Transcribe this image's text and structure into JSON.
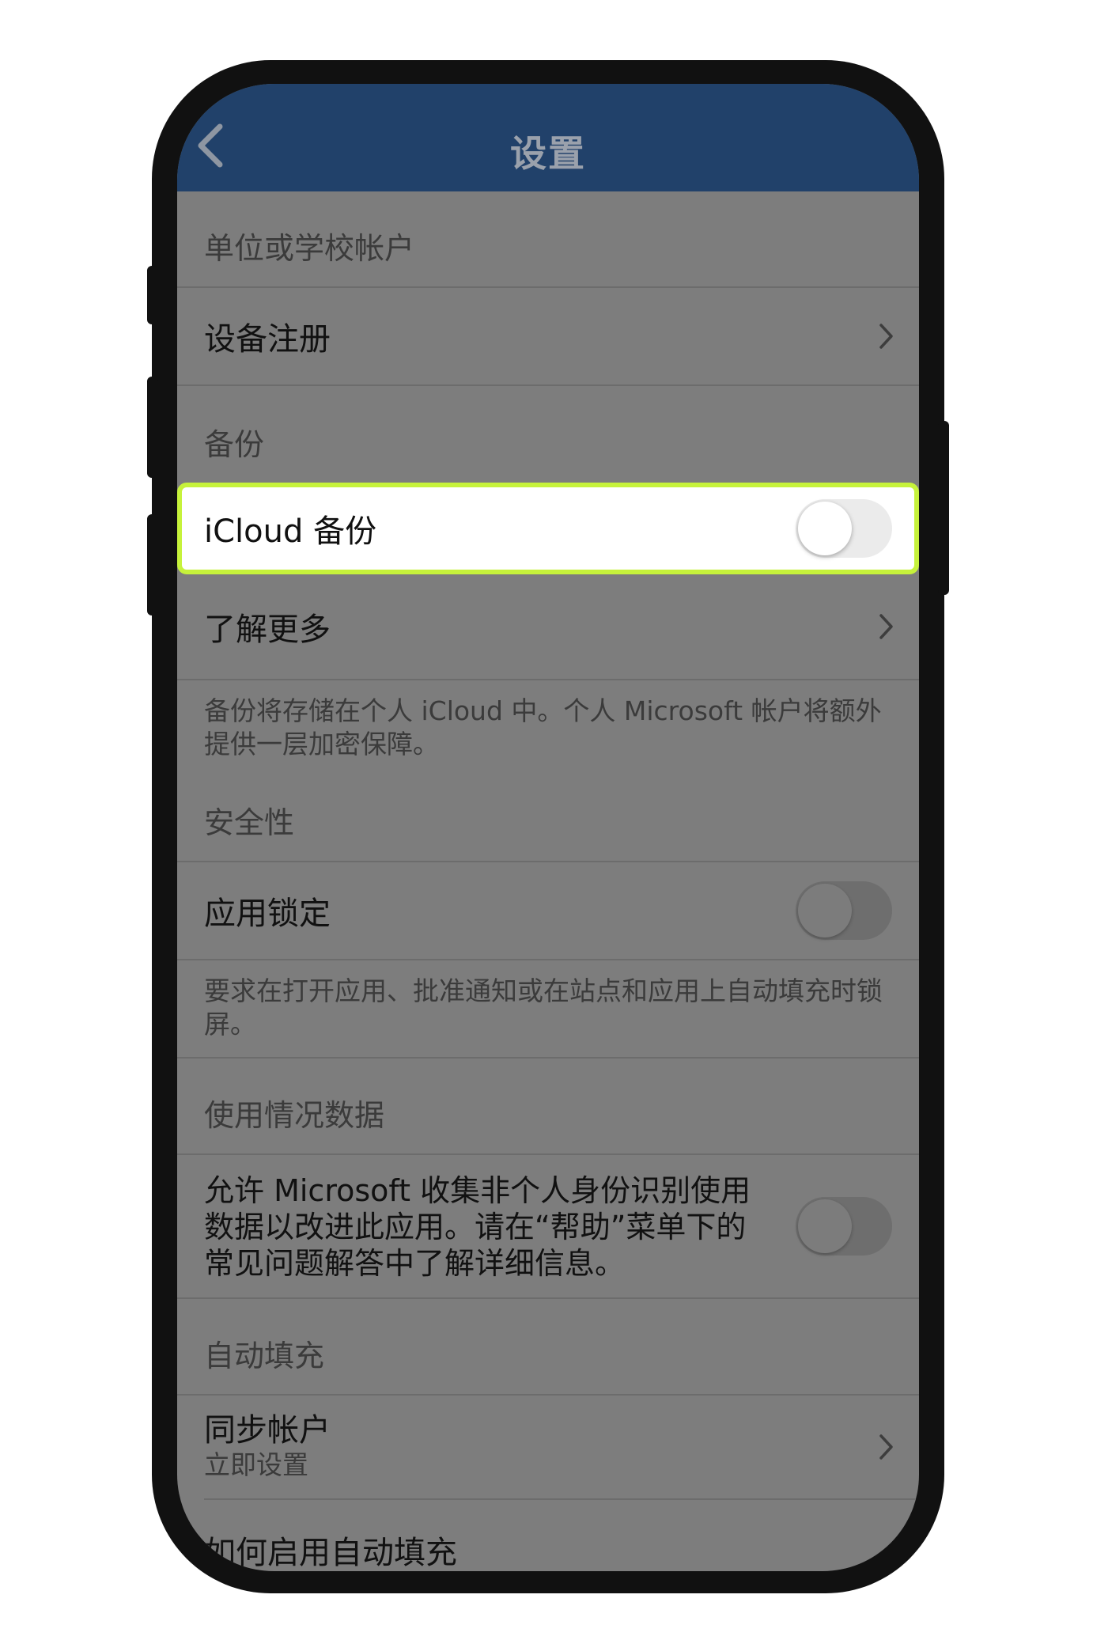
{
  "nav": {
    "title": "设置",
    "back_icon": "chevron-left-icon"
  },
  "sections": {
    "work_account": {
      "header": "单位或学校帐户",
      "device_registration": "设备注册"
    },
    "backup": {
      "header": "备份",
      "icloud_backup": {
        "label": "iCloud 备份",
        "enabled": false
      },
      "learn_more": "了解更多",
      "footnote": "备份将存储在个人 iCloud 中。个人 Microsoft 帐户将额外提供一层加密保障。"
    },
    "security": {
      "header": "安全性",
      "app_lock": {
        "label": "应用锁定",
        "enabled": false
      },
      "footnote": "要求在打开应用、批准通知或在站点和应用上自动填充时锁屏。"
    },
    "usage_data": {
      "header": "使用情况数据",
      "allow_collect": {
        "label_line1": "允许 Microsoft 收集非个人身份识别使用",
        "label_line2": "数据以改进此应用。请在“帮助”菜单下的",
        "label_line3": "常见问题解答中了解详细信息。",
        "enabled": false
      }
    },
    "autofill": {
      "header": "自动填充",
      "sync_account": {
        "label": "同步帐户",
        "sublabel": "立即设置"
      },
      "how_to_enable": "如何启用自动填充"
    }
  },
  "colors": {
    "navbar": "#21416a",
    "overlay_gray": "#7d7d7d",
    "highlight_border": "#c6f23b"
  }
}
